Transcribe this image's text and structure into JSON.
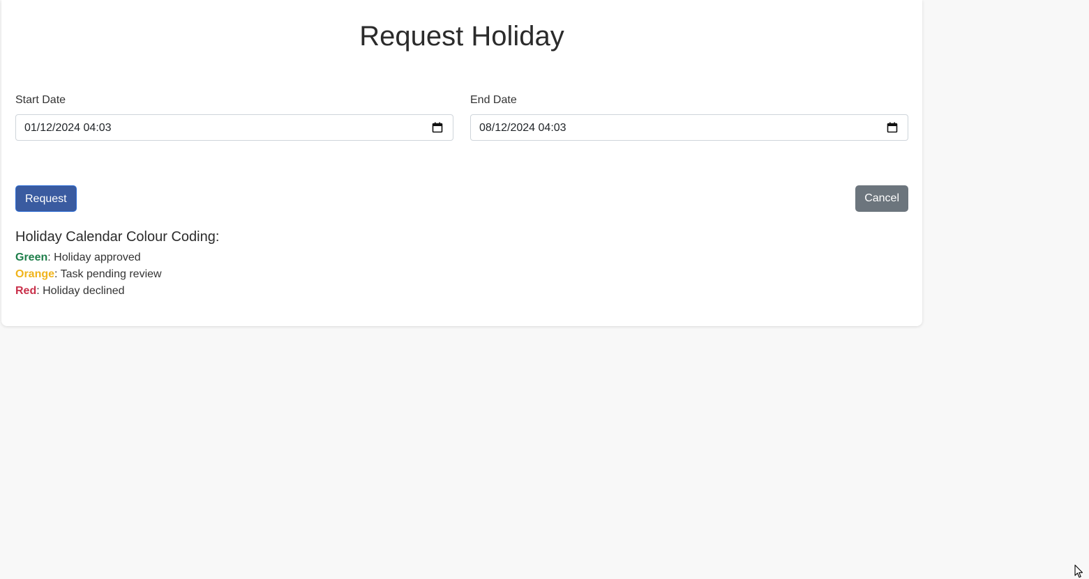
{
  "page": {
    "title": "Request Holiday"
  },
  "form": {
    "start": {
      "label": "Start Date",
      "value": "01/12/2024 04:03",
      "icon": "calendar-icon"
    },
    "end": {
      "label": "End Date",
      "value": "08/12/2024 04:03",
      "icon": "calendar-icon"
    }
  },
  "actions": {
    "request_label": "Request",
    "cancel_label": "Cancel"
  },
  "legend": {
    "title": "Holiday Calendar Colour Coding:",
    "items": [
      {
        "color_name": "Green",
        "description": ": Holiday approved",
        "color": "#1e7e4a"
      },
      {
        "color_name": "Orange",
        "description": ": Task pending review",
        "color": "#f0b41c"
      },
      {
        "color_name": "Red",
        "description": ": Holiday declined",
        "color": "#c9304a"
      }
    ]
  },
  "colors": {
    "request_button": "#3a5ba0",
    "cancel_button": "#6c757d",
    "page_background": "#f8f8f8"
  }
}
